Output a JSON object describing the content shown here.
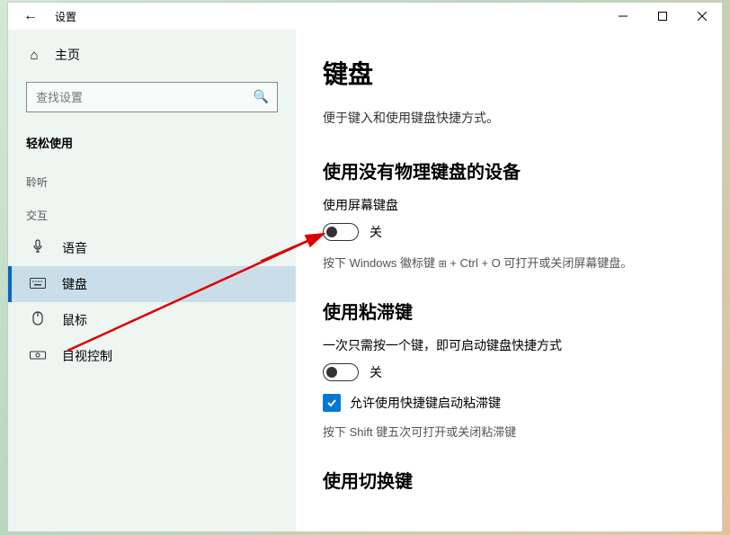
{
  "titlebar": {
    "back": "←",
    "title": "设置"
  },
  "sidebar": {
    "home": "主页",
    "search_placeholder": "查找设置",
    "section": "轻松使用",
    "groups": [
      {
        "label": "聆听",
        "items": []
      },
      {
        "label": "交互",
        "items": [
          {
            "icon": "mic",
            "label": "语音",
            "selected": false
          },
          {
            "icon": "keyboard",
            "label": "键盘",
            "selected": true
          },
          {
            "icon": "mouse",
            "label": "鼠标",
            "selected": false
          },
          {
            "icon": "eye",
            "label": "目视控制",
            "selected": false
          }
        ]
      }
    ]
  },
  "main": {
    "title": "键盘",
    "intro": "便于键入和使用键盘快捷方式。",
    "s1": {
      "heading": "使用没有物理键盘的设备",
      "label": "使用屏幕键盘",
      "state": "关",
      "hint_pre": "按下 Windows 徽标键 ",
      "hint_post": " + Ctrl + O 可打开或关闭屏幕键盘。"
    },
    "s2": {
      "heading": "使用粘滞键",
      "label": "一次只需按一个键，即可启动键盘快捷方式",
      "state": "关",
      "checkbox": "允许使用快捷键启动粘滞键",
      "hint": "按下 Shift 键五次可打开或关闭粘滞键"
    },
    "s3": {
      "heading": "使用切换键"
    }
  }
}
